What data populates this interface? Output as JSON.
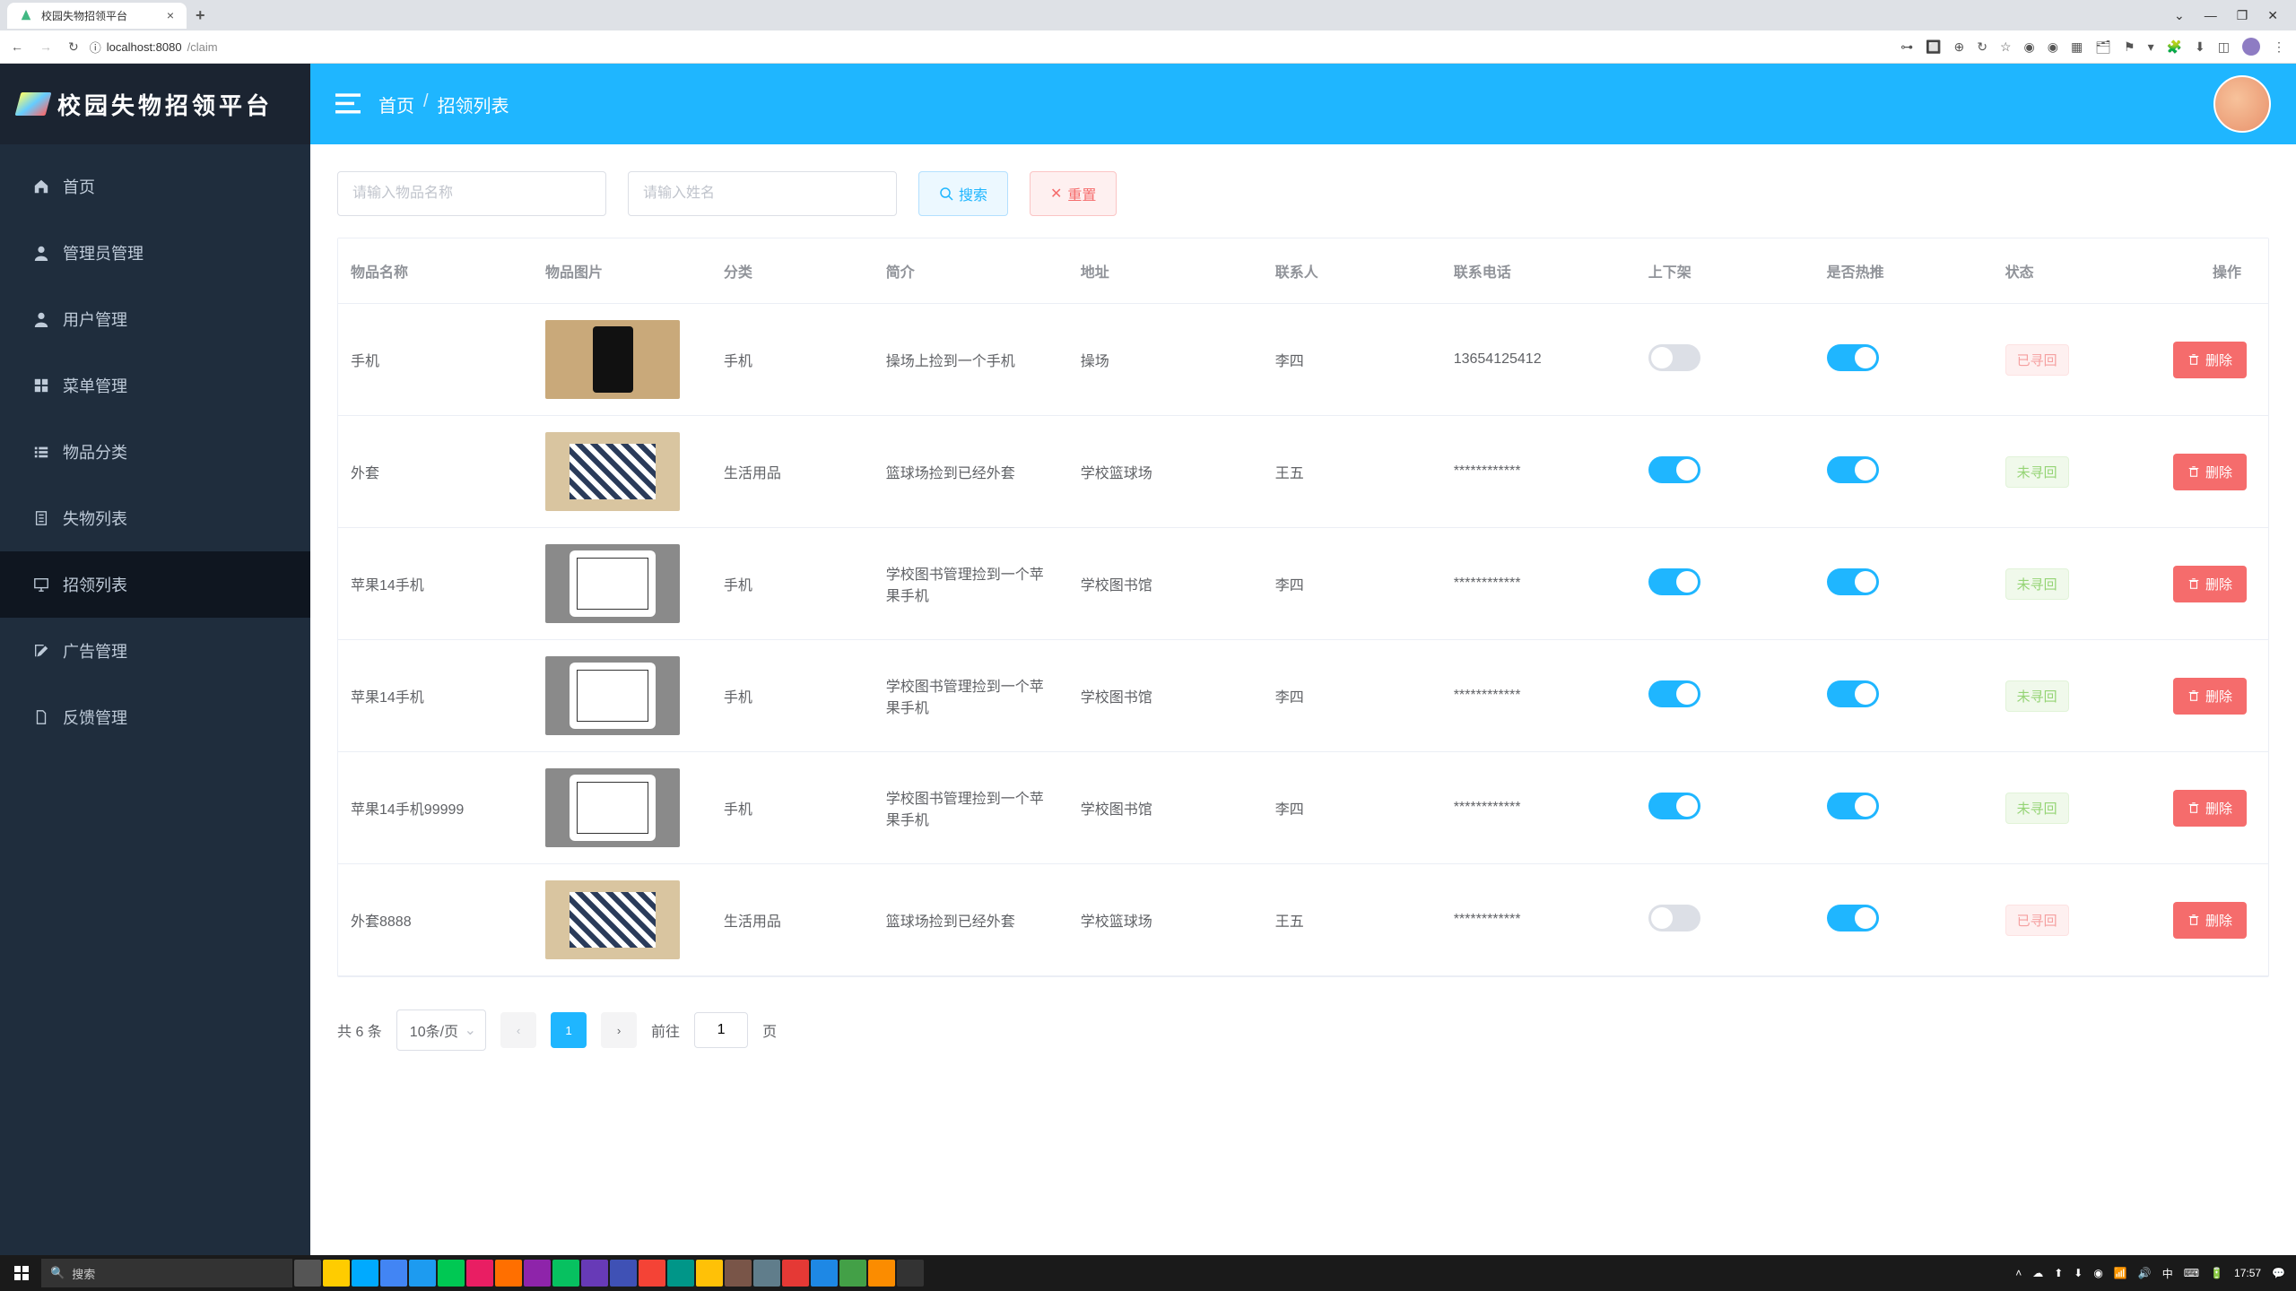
{
  "browser": {
    "tab_title": "校园失物招领平台",
    "url_prefix": "localhost:8080",
    "url_path": "/claim",
    "win_min": "—",
    "win_max": "❐",
    "win_close": "✕",
    "win_chev": "⌄"
  },
  "app": {
    "logo_text": "校园失物招领平台"
  },
  "sidebar": {
    "items": [
      {
        "icon": "home",
        "label": "首页"
      },
      {
        "icon": "user",
        "label": "管理员管理"
      },
      {
        "icon": "user",
        "label": "用户管理"
      },
      {
        "icon": "grid",
        "label": "菜单管理"
      },
      {
        "icon": "list",
        "label": "物品分类"
      },
      {
        "icon": "doc",
        "label": "失物列表"
      },
      {
        "icon": "monitor",
        "label": "招领列表"
      },
      {
        "icon": "edit",
        "label": "广告管理"
      },
      {
        "icon": "file",
        "label": "反馈管理"
      }
    ],
    "active_index": 6
  },
  "breadcrumb": {
    "home": "首页",
    "current": "招领列表"
  },
  "search": {
    "name_placeholder": "请输入物品名称",
    "contact_placeholder": "请输入姓名",
    "search_label": "搜索",
    "reset_label": "重置"
  },
  "table": {
    "headers": {
      "name": "物品名称",
      "image": "物品图片",
      "category": "分类",
      "intro": "简介",
      "address": "地址",
      "contact": "联系人",
      "phone": "联系电话",
      "updown": "上下架",
      "hot": "是否热推",
      "status": "状态",
      "action": "操作"
    },
    "rows": [
      {
        "name": "手机",
        "img": "phone",
        "category": "手机",
        "intro": "操场上捡到一个手机",
        "address": "操场",
        "contact": "李四",
        "phone": "13654125412",
        "updown": false,
        "hot": true,
        "status": "found"
      },
      {
        "name": "外套",
        "img": "jacket",
        "category": "生活用品",
        "intro": "篮球场捡到已经外套",
        "address": "学校篮球场",
        "contact": "王五",
        "phone": "************",
        "updown": true,
        "hot": true,
        "status": "notfound"
      },
      {
        "name": "苹果14手机",
        "img": "ipad",
        "category": "手机",
        "intro": "学校图书管理捡到一个苹果手机",
        "address": "学校图书馆",
        "contact": "李四",
        "phone": "************",
        "updown": true,
        "hot": true,
        "status": "notfound"
      },
      {
        "name": "苹果14手机",
        "img": "ipad",
        "category": "手机",
        "intro": "学校图书管理捡到一个苹果手机",
        "address": "学校图书馆",
        "contact": "李四",
        "phone": "************",
        "updown": true,
        "hot": true,
        "status": "notfound"
      },
      {
        "name": "苹果14手机99999",
        "img": "ipad",
        "category": "手机",
        "intro": "学校图书管理捡到一个苹果手机",
        "address": "学校图书馆",
        "contact": "李四",
        "phone": "************",
        "updown": true,
        "hot": true,
        "status": "notfound"
      },
      {
        "name": "外套8888",
        "img": "jacket",
        "category": "生活用品",
        "intro": "篮球场捡到已经外套",
        "address": "学校篮球场",
        "contact": "王五",
        "phone": "************",
        "updown": false,
        "hot": true,
        "status": "found"
      }
    ],
    "status_labels": {
      "found": "已寻回",
      "notfound": "未寻回"
    },
    "delete_label": "删除"
  },
  "pagination": {
    "total_text": "共 6 条",
    "page_size": "10条/页",
    "current": "1",
    "goto_prefix": "前往",
    "goto_value": "1",
    "goto_suffix": "页"
  },
  "taskbar": {
    "search_placeholder": "搜索",
    "time": "17:57"
  }
}
